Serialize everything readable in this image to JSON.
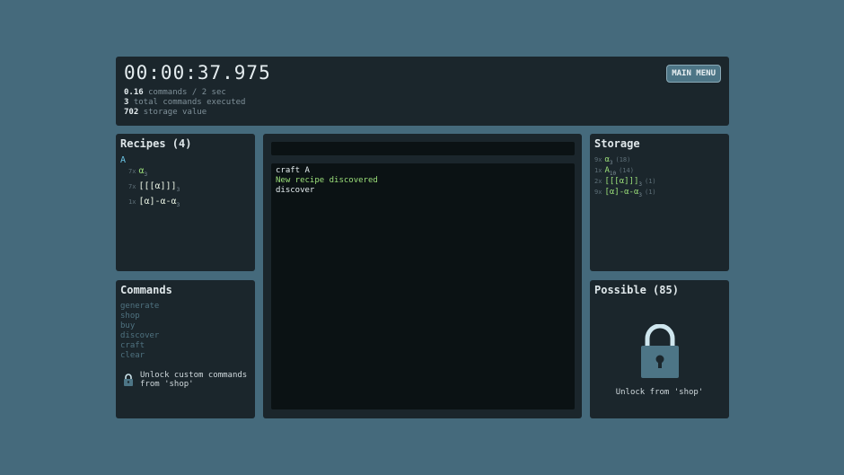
{
  "header": {
    "timer": "00:00:37.975",
    "stats": [
      {
        "value": "0.16",
        "label": "commands / 2 sec"
      },
      {
        "value": "3",
        "label": "total commands executed"
      },
      {
        "value": "702",
        "label": "storage value"
      }
    ],
    "main_menu_label": "MAIN MENU"
  },
  "recipes": {
    "title": "Recipes (4)",
    "selected": "A",
    "items": [
      {
        "count": "7x",
        "name": "α",
        "sub": "3"
      },
      {
        "count": "7x",
        "name": "[[[α]]]",
        "sub": "3"
      },
      {
        "count": "1x",
        "name": "[α]-α-α",
        "sub": "3"
      }
    ]
  },
  "commands": {
    "title": "Commands",
    "items": [
      "generate",
      "shop",
      "buy",
      "discover",
      "craft",
      "clear"
    ],
    "unlock_text_line1": "Unlock custom commands",
    "unlock_text_line2": "from 'shop'"
  },
  "console": {
    "input_value": "",
    "lines": [
      {
        "text": "craft A",
        "color": "#e4ecef"
      },
      {
        "text": "New recipe discovered",
        "color": "#9ce07a"
      },
      {
        "text": "discover",
        "color": "#e4ecef"
      }
    ]
  },
  "storage": {
    "title": "Storage",
    "items": [
      {
        "count": "9x",
        "name": "α",
        "sub": "3",
        "qty": "(18)"
      },
      {
        "count": "1x",
        "name": "A",
        "sub": "10",
        "qty": "(14)"
      },
      {
        "count": "2x",
        "name": "[[[α]]]",
        "sub": "3",
        "qty": "(1)"
      },
      {
        "count": "9x",
        "name": "[α]-α-α",
        "sub": "3",
        "qty": "(1)"
      }
    ]
  },
  "possible": {
    "title": "Possible (85)",
    "unlock_text": "Unlock from 'shop'",
    "icon": "lock-icon"
  },
  "colors": {
    "background": "#456a7c",
    "panel": "#1b262c",
    "console_bg": "#0b1214",
    "accent_green": "#9ce07a",
    "accent_blue": "#6cc6e6",
    "lock_body": "#4d7586",
    "lock_shackle": "#cfe6ee"
  }
}
